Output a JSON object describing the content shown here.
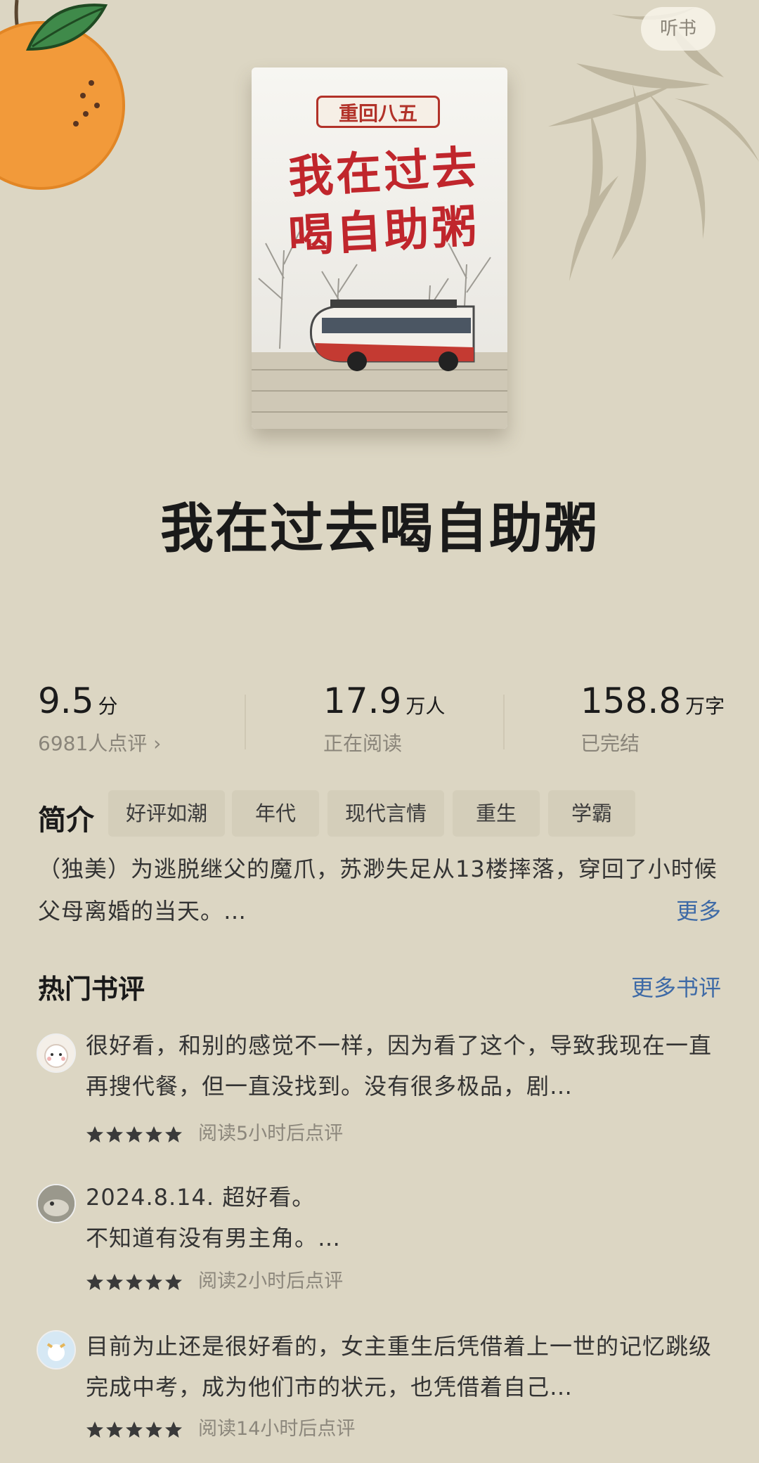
{
  "header": {
    "listen_label": "听书"
  },
  "cover": {
    "tag": "重回八五",
    "title_line1": "我在过去",
    "title_line2": "喝自助粥"
  },
  "book": {
    "title": "我在过去喝自助粥"
  },
  "stats": {
    "rating": {
      "value": "9.5",
      "unit": "分",
      "sub": "6981人点评 ›"
    },
    "readers": {
      "value": "17.9",
      "unit": "万人",
      "sub": "正在阅读"
    },
    "words": {
      "value": "158.8",
      "unit": "万字",
      "sub": "已完结"
    }
  },
  "intro": {
    "label": "简介",
    "tags": [
      "好评如潮",
      "年代",
      "现代言情",
      "重生",
      "学霸"
    ],
    "description": "（独美）为逃脱继父的魔爪，苏渺失足从13楼摔落，穿回了小时候父母离婚的当天。…",
    "more_label": "更多"
  },
  "reviews_section": {
    "title": "热门书评",
    "more_label": "更多书评",
    "reviews": [
      {
        "text": "很好看，和别的感觉不一样，因为看了这个，导致我现在一直再搜代餐，但一直没找到。没有很多极品，剧…",
        "stars": 5,
        "meta": "阅读5小时后点评"
      },
      {
        "text": "2024.8.14.    超好看。\n不知道有没有男主角。…",
        "stars": 5,
        "meta": "阅读2小时后点评"
      },
      {
        "text": "目前为止还是很好看的，女主重生后凭借着上一世的记忆跳级完成中考，成为他们市的状元，也凭借着自己…",
        "stars": 5,
        "meta": "阅读14小时后点评"
      }
    ]
  },
  "colors": {
    "background": "#dcd6c3",
    "link": "#3e6aa6",
    "cover_red": "#c0262c"
  },
  "icons": [
    "orange-fruit-icon",
    "bamboo-leaves-icon",
    "chevron-right-icon",
    "star-icon"
  ]
}
